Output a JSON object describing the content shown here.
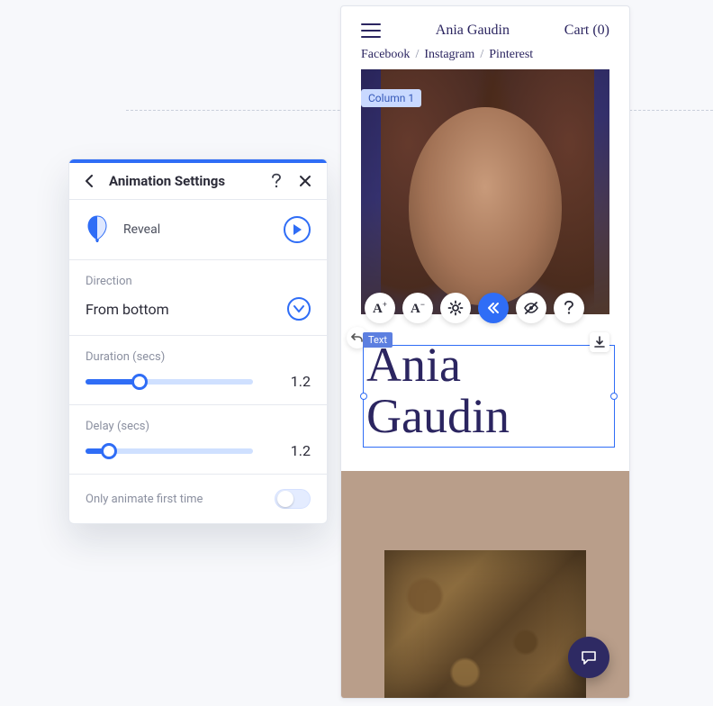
{
  "panel": {
    "title": "Animation Settings",
    "preset_label": "Reveal",
    "direction": {
      "label": "Direction",
      "value": "From bottom"
    },
    "duration": {
      "label": "Duration (secs)",
      "value": "1.2",
      "percent": 32
    },
    "delay": {
      "label": "Delay (secs)",
      "value": "1.2",
      "percent": 14
    },
    "only_first": {
      "label": "Only animate first time",
      "on": false
    }
  },
  "preview": {
    "brand": "Ania Gaudin",
    "cart_label": "Cart (0)",
    "socials": [
      "Facebook",
      "Instagram",
      "Pinterest"
    ],
    "column_tag": "Column 1",
    "text_tag": "Text",
    "hero_title": "Ania Gaudin"
  }
}
